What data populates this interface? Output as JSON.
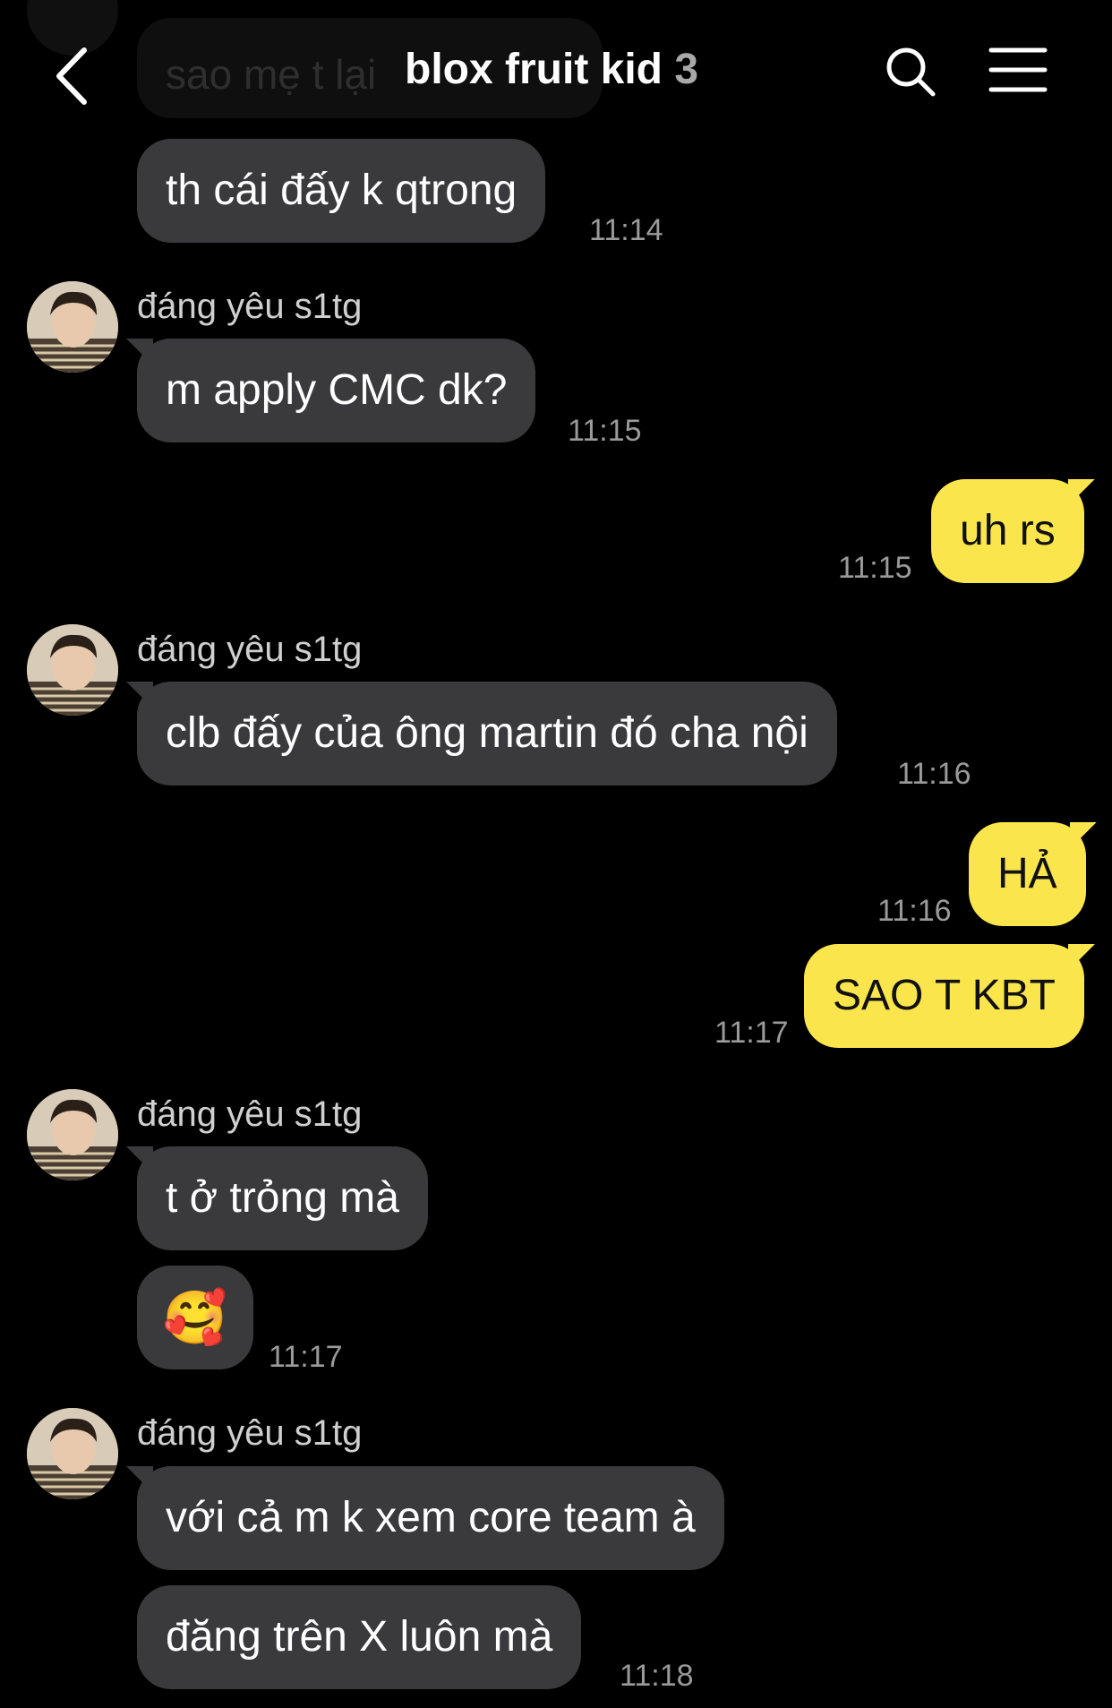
{
  "header": {
    "title": "blox fruit kid",
    "member_count": "3",
    "back_icon": "chevron-left-icon",
    "search_icon": "search-icon",
    "menu_icon": "hamburger-menu-icon"
  },
  "colors": {
    "incoming_bubble": "#3a3a3c",
    "outgoing_bubble": "#fbe54d",
    "background": "#000000"
  },
  "ghost_message": "sao mẹ t lại",
  "messages": [
    {
      "text": "th cái đấy k qtrong",
      "time": "11:14"
    },
    {
      "sender": "đáng yêu s1tg",
      "text": "m apply CMC dk?",
      "time": "11:15"
    },
    {
      "text": "uh rs",
      "time": "11:15"
    },
    {
      "sender": "đáng yêu s1tg",
      "text": "clb đấy của ông martin đó cha nội",
      "time": "11:16"
    },
    {
      "text": "HẢ",
      "time": "11:16"
    },
    {
      "text": "SAO T KBT",
      "time": "11:17"
    },
    {
      "sender": "đáng yêu s1tg",
      "text": "t ở trỏng mà"
    },
    {
      "text": "🥰",
      "time": "11:17"
    },
    {
      "sender": "đáng yêu s1tg",
      "text": "với cả m k xem core team à"
    },
    {
      "text": "đăng trên X luôn mà",
      "time": "11:18"
    }
  ]
}
